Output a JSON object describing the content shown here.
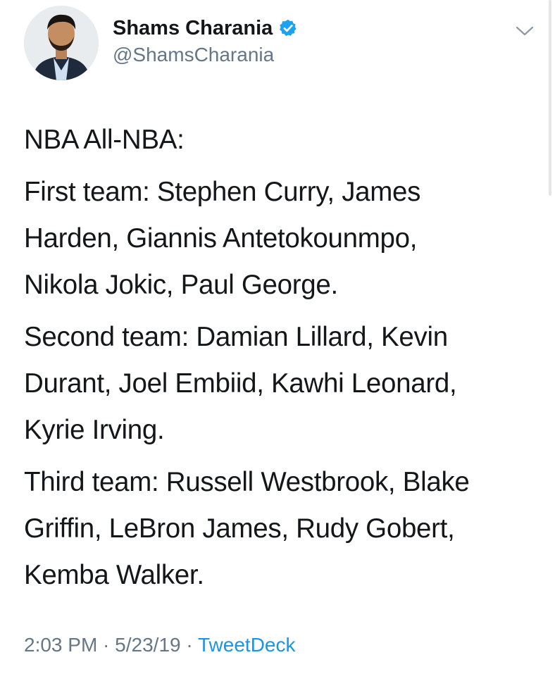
{
  "author": {
    "display_name": "Shams Charania",
    "handle": "@ShamsCharania",
    "verified": true,
    "verified_icon": "verified-badge-icon",
    "verified_color": "#1da1f2"
  },
  "tweet": {
    "heading": "NBA All-NBA:",
    "paragraphs": [
      {
        "lines": [
          "First team: Stephen Curry, James",
          "Harden, Giannis Antetokounmpo,",
          "Nikola Jokic, Paul George."
        ]
      },
      {
        "lines": [
          "Second team: Damian Lillard, Kevin",
          "Durant, Joel Embiid, Kawhi Leonard,",
          "Kyrie Irving."
        ]
      },
      {
        "lines": [
          "Third team: Russell Westbrook, Blake",
          "Griffin, LeBron James, Rudy Gobert,",
          "Kemba Walker."
        ]
      }
    ]
  },
  "meta": {
    "time": "2:03 PM",
    "separator": " · ",
    "date": "5/23/19",
    "source": "TweetDeck"
  },
  "icons": {
    "menu": "chevron-down-icon"
  },
  "colors": {
    "text": "#14171a",
    "secondary": "#657786",
    "link": "#1b95e0"
  }
}
